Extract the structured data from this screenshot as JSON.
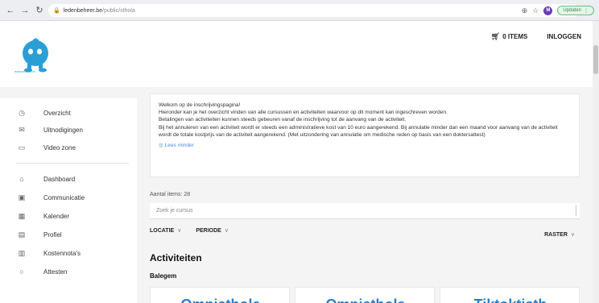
{
  "browser": {
    "url_host": "ledenbeheer.be",
    "url_path": "/public/sthola",
    "avatar_letter": "M",
    "update_label": "Updaten",
    "icons": [
      "back-icon",
      "forward-icon",
      "reload-icon",
      "lock-icon",
      "translate-icon",
      "star-icon"
    ]
  },
  "header": {
    "logo_text": "www.sthola.be",
    "cart_label": "0 ITEMS",
    "login_label": "INLOGGEN"
  },
  "sidebar": {
    "items": [
      {
        "label": "Overzicht",
        "icon": "dashboard-icon"
      },
      {
        "label": "Uitnodigingen",
        "icon": "mail-icon"
      },
      {
        "label": "Video zone",
        "icon": "video-icon"
      },
      {
        "label": "Dashboard",
        "icon": "home-icon"
      },
      {
        "label": "Communicatie",
        "icon": "inbox-icon"
      },
      {
        "label": "Kalender",
        "icon": "calendar-icon"
      },
      {
        "label": "Profiel",
        "icon": "profile-icon"
      },
      {
        "label": "Kostennota's",
        "icon": "receipt-icon"
      },
      {
        "label": "Attesten",
        "icon": "circle-icon"
      }
    ]
  },
  "info": {
    "line1": "Welkom op de inschrijvingspagina!",
    "line2": "Hieronder kan je het overzicht vinden van alle cursussen en activiteiten waarvoor op dit moment kan ingeschreven worden.",
    "line3": "Betalingen van activiteiten kunnen steeds gebeuren vanaf de inschrijving tot de aanvang van de activiteit.",
    "line4": "Bij het annuleren van een activiteit wordt er steeds een administratieve kost van 10 euro aangerekend. Bij annulatie minder dan een maand voor aanvang van de activiteit wordt de totale kostprijs van de activiteit aangerekend. (Met uitzondering van annulatie om medische reden op basis van een doktersattest)",
    "read_less": "Lees minder"
  },
  "listing": {
    "count_label": "Aantal items: 28",
    "search_placeholder": "Zoek je cursus",
    "filter_location": "LOCATIE",
    "filter_period": "PERIODE",
    "view_label": "RASTER",
    "section_title": "Activiteiten",
    "location_heading": "Balegem",
    "cards": [
      "Omnisthola",
      "Omnisthola",
      "Tiktoktisth"
    ]
  },
  "colors": {
    "accent_blue": "#2a7fc8",
    "link_blue": "#4a8fd8",
    "logo_blue": "#2a9fd6"
  }
}
